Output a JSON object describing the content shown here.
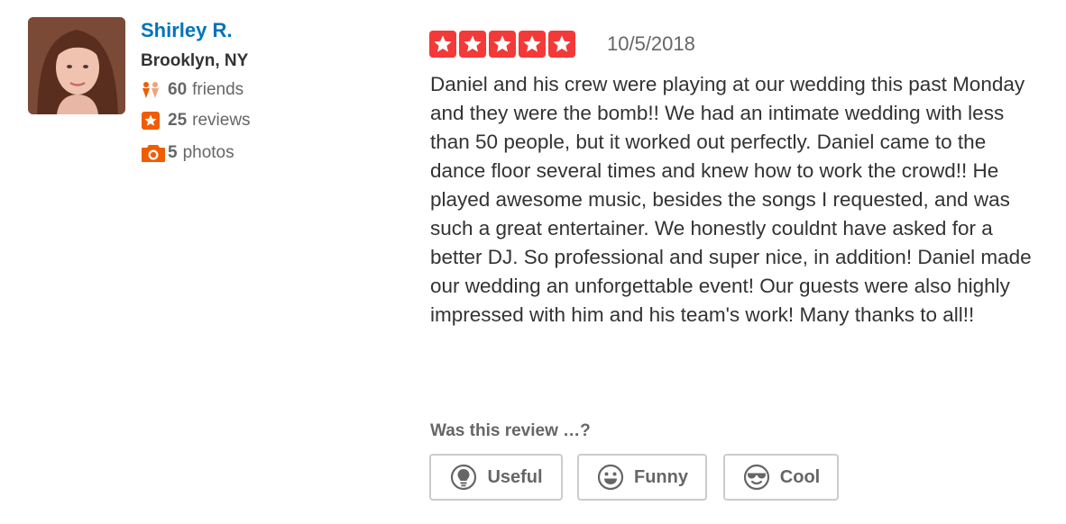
{
  "user": {
    "name": "Shirley R.",
    "location": "Brooklyn, NY",
    "friends_count": "60",
    "friends_label": "friends",
    "reviews_count": "25",
    "reviews_label": "reviews",
    "photos_count": "5",
    "photos_label": "photos"
  },
  "review": {
    "rating": 5,
    "date": "10/5/2018",
    "text": "Daniel and his crew were playing at our wedding this past Monday and they were the bomb!! We had an intimate wedding with less than 50 people, but it worked out perfectly. Daniel came to the dance floor several times and knew how to work the crowd!! He played awesome music, besides the songs I requested, and was such a great entertainer. We honestly couldnt have asked for a better DJ. So professional and super nice, in addition! Daniel made our wedding an unforgettable event! Our guests were also highly impressed with him and his team's work! Many thanks to all!!"
  },
  "votes": {
    "prompt": "Was this review …?",
    "useful_label": "Useful",
    "funny_label": "Funny",
    "cool_label": "Cool"
  },
  "colors": {
    "accent_star": "#f43939",
    "link": "#0073bb",
    "stat_icon": "#f15c00"
  },
  "icons": [
    "friends-icon",
    "review-star-icon",
    "camera-icon",
    "lightbulb-icon",
    "smiley-icon",
    "sunglasses-icon",
    "star-icon"
  ]
}
